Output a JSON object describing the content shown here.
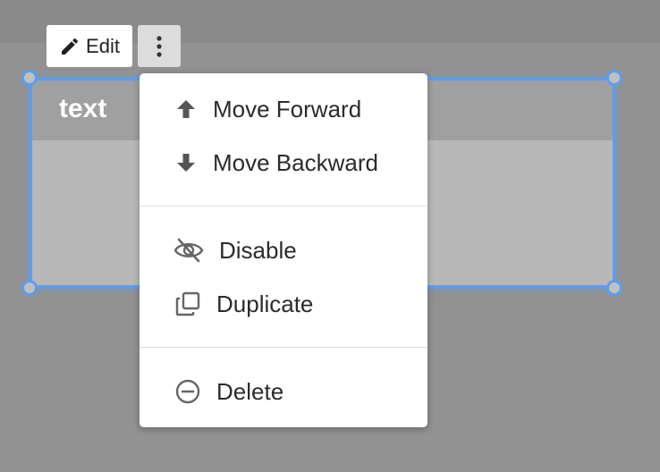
{
  "toolbar": {
    "edit_label": "Edit",
    "edit_icon": "pencil-icon",
    "more_icon": "more-vertical-icon"
  },
  "widget": {
    "title": "text"
  },
  "menu": {
    "move_forward": {
      "label": "Move Forward",
      "icon": "arrow-up-icon"
    },
    "move_backward": {
      "label": "Move Backward",
      "icon": "arrow-down-icon"
    },
    "disable": {
      "label": "Disable",
      "icon": "eye-off-icon"
    },
    "duplicate": {
      "label": "Duplicate",
      "icon": "duplicate-icon"
    },
    "delete": {
      "label": "Delete",
      "icon": "minus-circle-icon"
    }
  },
  "colors": {
    "selection": "#5a9ef0",
    "background": "#929292"
  }
}
